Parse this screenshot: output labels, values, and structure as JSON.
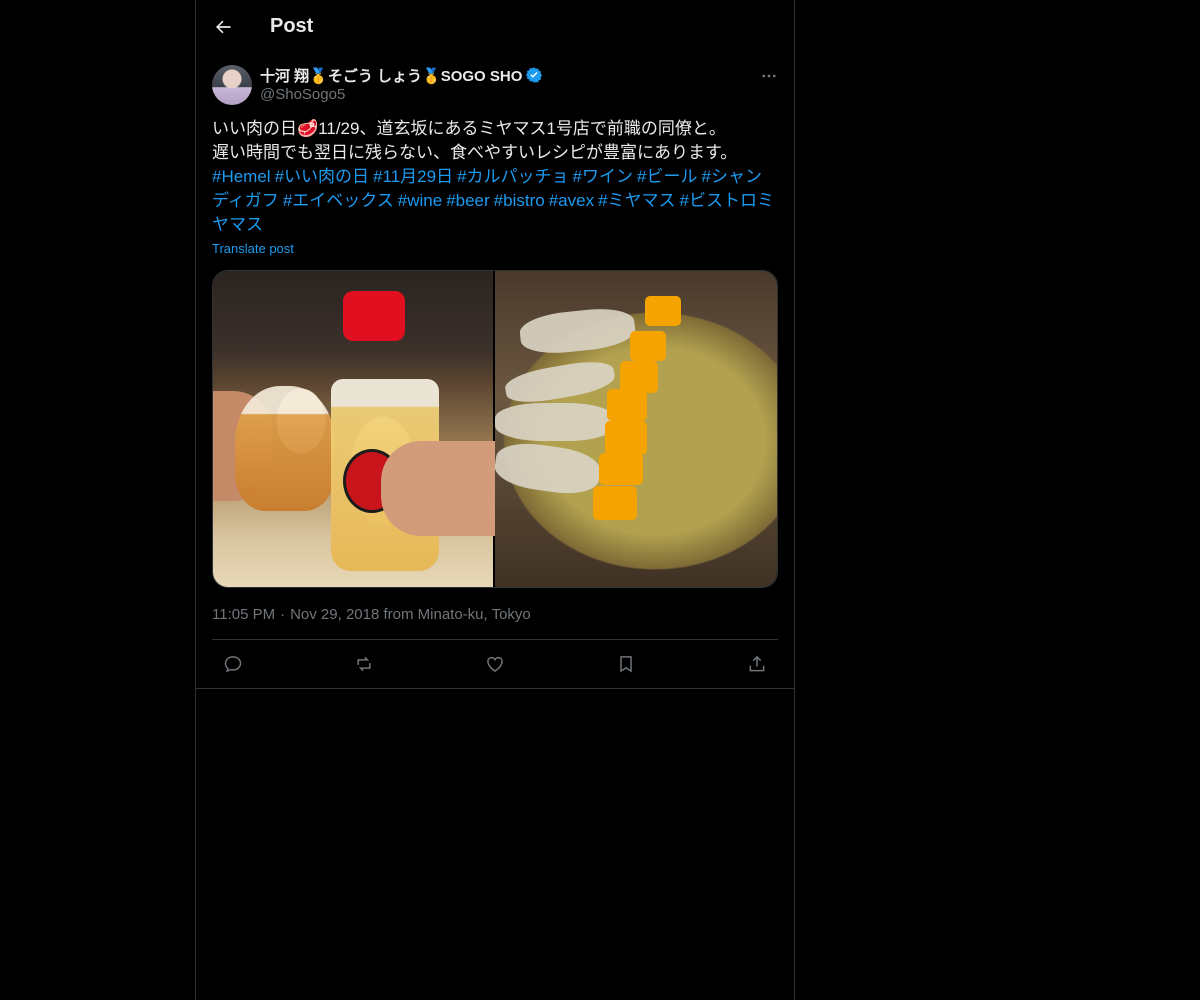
{
  "header": {
    "title": "Post"
  },
  "author": {
    "display_name": "十河 翔🥇そごう しょう🥇SOGO SHO",
    "handle": "@ShoSogo5",
    "verified": true
  },
  "post": {
    "line1": "いい肉の日🥩11/29、道玄坂にあるミヤマス1号店で前職の同僚と。",
    "line2": "遅い時間でも翌日に残らない、食べやすいレシピが豊富にあります。",
    "hashtags": [
      "#Hemel",
      "#いい肉の日",
      "#11月29日",
      "#カルパッチョ",
      "#ワイン",
      "#ビール",
      "#シャンディガフ",
      "#エイベックス",
      "#wine",
      "#beer",
      "#bistro",
      "#avex",
      "#ミヤマス",
      "#ビストロミヤマス"
    ],
    "translate_label": "Translate post"
  },
  "meta": {
    "time": "11:05 PM",
    "separator": "·",
    "date_location": "Nov 29, 2018 from Minato-ku, Tokyo"
  },
  "icons": {
    "back": "arrow-left-icon",
    "more": "more-horizontal-icon",
    "verified": "verified-badge-icon",
    "reply": "reply-icon",
    "repost": "repost-icon",
    "like": "heart-icon",
    "bookmark": "bookmark-icon",
    "share": "share-icon"
  },
  "colors": {
    "background": "#000000",
    "text": "#e7e9ea",
    "secondary": "#71767b",
    "accent": "#1d9bf0",
    "border": "#2f3336"
  }
}
